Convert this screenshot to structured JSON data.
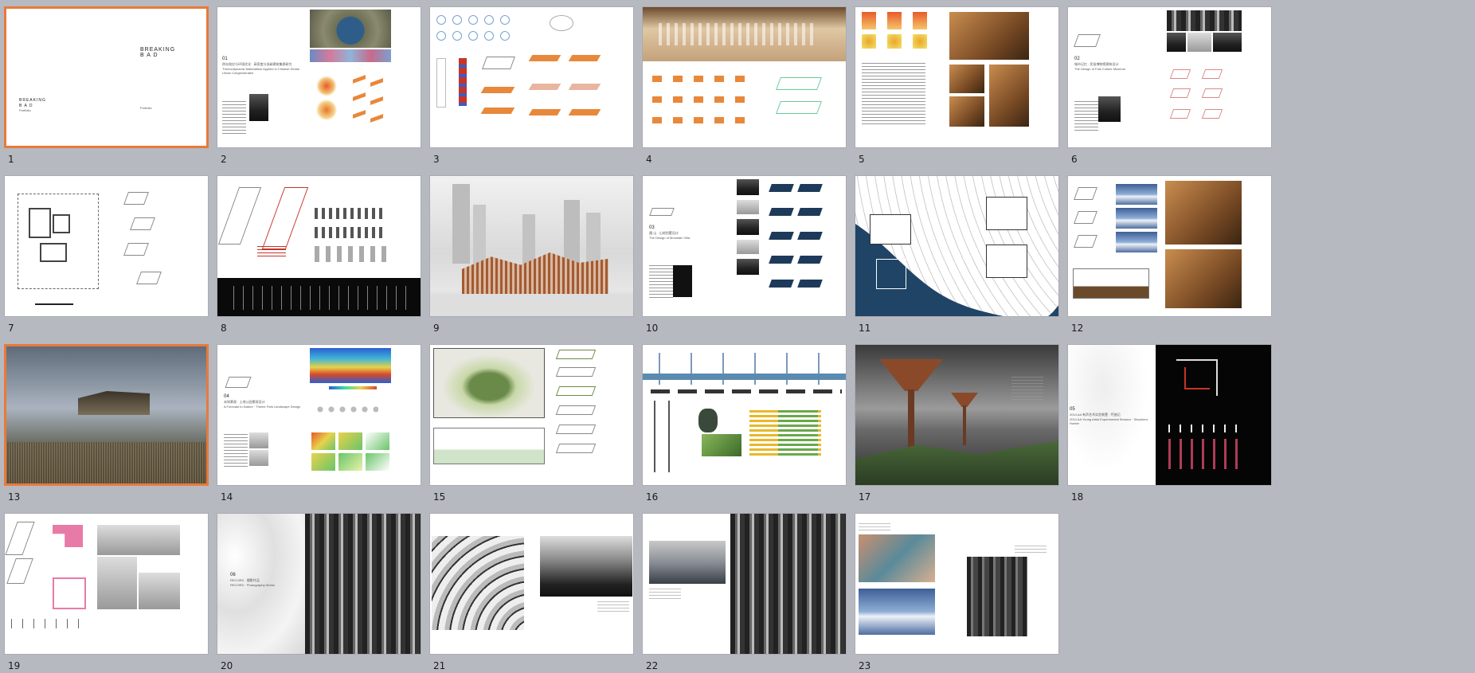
{
  "slides": [
    {
      "num": "1",
      "selected": true,
      "title": "BREAKING\nB A D",
      "subtitle": "Portfolio"
    },
    {
      "num": "2",
      "selected": false,
      "section": "01",
      "title_cn": "热岛效应与环境优化 · 高密度与低碳建筑集群研究",
      "title_en": "Thermodynamic Materialism Applied in Chinese Dense Urban Conglomerates"
    },
    {
      "num": "3",
      "selected": false
    },
    {
      "num": "4",
      "selected": false
    },
    {
      "num": "5",
      "selected": false
    },
    {
      "num": "6",
      "selected": false,
      "section": "02",
      "title_cn": "城市记忆 · 民俗博物馆建筑设计",
      "title_en": "The Design of Folk Culture Museum"
    },
    {
      "num": "7",
      "selected": false
    },
    {
      "num": "8",
      "selected": false
    },
    {
      "num": "9",
      "selected": false
    },
    {
      "num": "10",
      "selected": false,
      "section": "03",
      "title_cn": "遇·山 · 山地别墅设计",
      "title_en": "The Design of Mountain Villa"
    },
    {
      "num": "11",
      "selected": false
    },
    {
      "num": "12",
      "selected": false
    },
    {
      "num": "13",
      "selected": true
    },
    {
      "num": "14",
      "selected": false,
      "section": "04",
      "title_cn": "未知景观 · 土地公园景观设计",
      "title_en": "A Forecast to Nature · Theme Park Landscape Design"
    },
    {
      "num": "15",
      "selected": false
    },
    {
      "num": "16",
      "selected": false
    },
    {
      "num": "17",
      "selected": false
    },
    {
      "num": "18",
      "selected": false,
      "section": "05",
      "title_cn": "2014 AA 有声艺术实验装置 · 哼曲记",
      "title_en": "2014 AA Young Artist Experimental Session · Shepherd Hunter"
    },
    {
      "num": "19",
      "selected": false
    },
    {
      "num": "20",
      "selected": false,
      "section": "06",
      "title_cn": "RECORD · 摄影作品",
      "title_en": "RECORD · Photography Works"
    },
    {
      "num": "21",
      "selected": false
    },
    {
      "num": "22",
      "selected": false
    },
    {
      "num": "23",
      "selected": false
    }
  ],
  "colors": {
    "background": "#b7b9c1",
    "selection": "#e87a3a",
    "slide": "#ffffff"
  }
}
